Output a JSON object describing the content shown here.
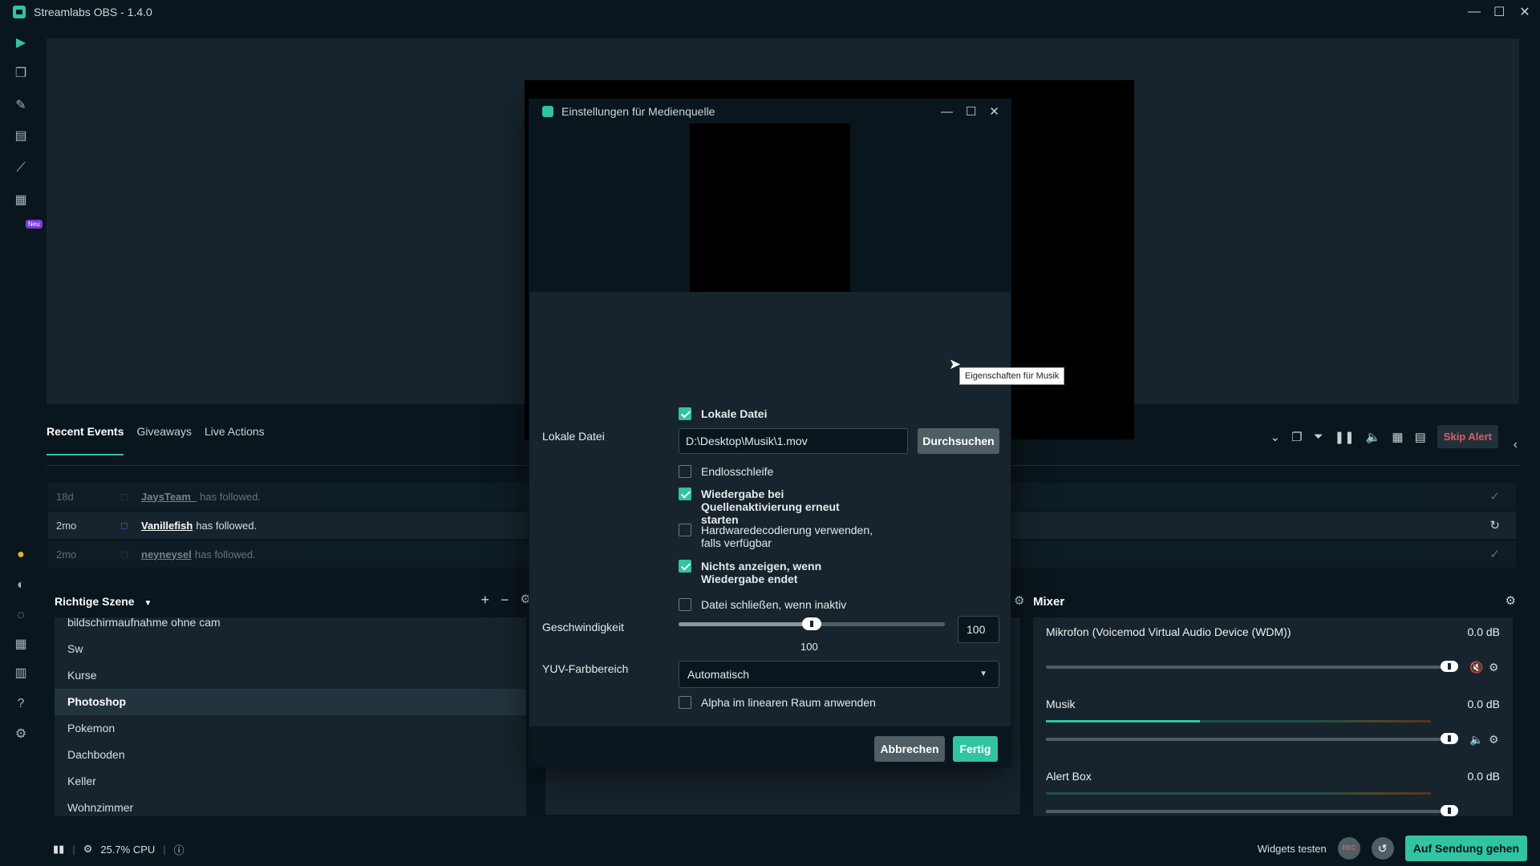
{
  "app": {
    "title": "Streamlabs OBS - 1.4.0"
  },
  "sidebar": {
    "new_badge": "Neu"
  },
  "events": {
    "tabs": [
      "Recent Events",
      "Giveaways",
      "Live Actions"
    ],
    "skip_alert": "Skip Alert",
    "rows": [
      {
        "age": "18d",
        "user": "JaysTeam_",
        "msg": "has followed."
      },
      {
        "age": "2mo",
        "user": "Vanillefish",
        "msg": "has followed."
      },
      {
        "age": "2mo",
        "user": "neyneysel",
        "msg": "has followed."
      }
    ]
  },
  "scenes": {
    "header": "Richtige Szene",
    "items": [
      "bildschirmaufnahme ohne cam",
      "Sw",
      "Kurse",
      "Photoshop",
      "Pokemon",
      "Dachboden",
      "Keller",
      "Wohnzimmer"
    ],
    "active": "Photoshop"
  },
  "mixer": {
    "header": "Mixer",
    "channels": [
      {
        "name": "Mikrofon (Voicemod Virtual Audio Device (WDM))",
        "db": "0.0 dB",
        "level": 0
      },
      {
        "name": "Musik",
        "db": "0.0 dB",
        "level": 0.4
      },
      {
        "name": "Alert Box",
        "db": "0.0 dB",
        "level": 0
      }
    ]
  },
  "statusbar": {
    "cpu": "25.7% CPU",
    "widgets_test": "Widgets testen",
    "rec": "REC",
    "go_live": "Auf Sendung gehen"
  },
  "dialog": {
    "title": "Einstellungen für Medienquelle",
    "local_file_checkbox": "Lokale Datei",
    "local_file_label": "Lokale Datei",
    "local_file_value": "D:\\Desktop\\Musik\\1.mov",
    "browse": "Durchsuchen",
    "tooltip": "Eigenschaften für Musik",
    "loop": "Endlosschleife",
    "restart": "Wiedergabe bei Quellenaktivierung erneut starten",
    "hw_decode": "Hardwaredecodierung verwenden, falls verfügbar",
    "hide_when_done": "Nichts anzeigen, wenn Wiedergabe endet",
    "close_inactive": "Datei schließen, wenn inaktiv",
    "speed_label": "Geschwindigkeit",
    "speed_value": "100",
    "speed_box": "100",
    "speed_fraction": 0.5,
    "yuv_label": "YUV-Farbbereich",
    "yuv_value": "Automatisch",
    "alpha": "Alpha im linearen Raum anwenden",
    "cancel": "Abbrechen",
    "done": "Fertig"
  }
}
